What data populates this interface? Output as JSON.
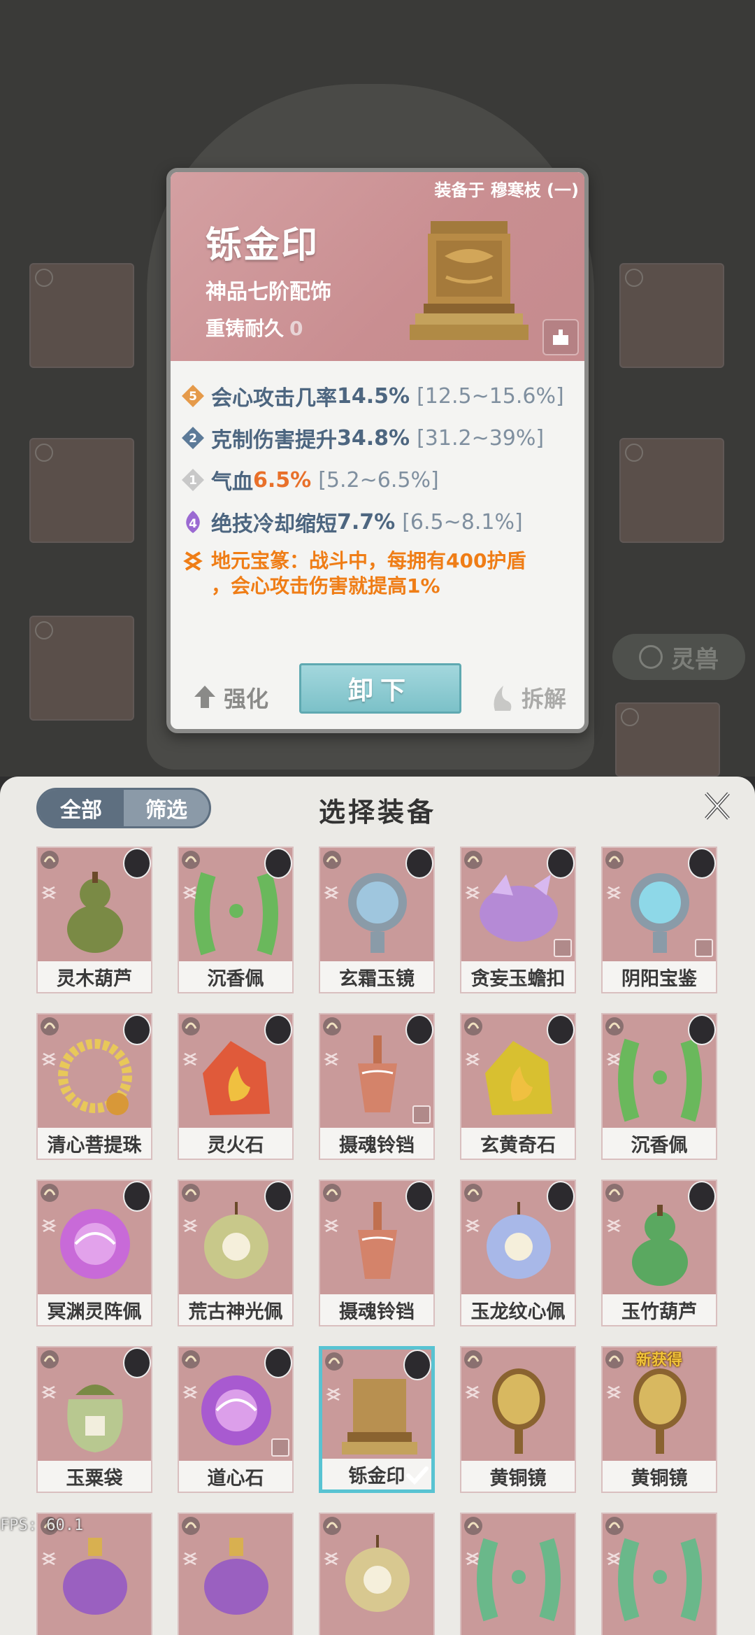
{
  "detail": {
    "equipped_on": "装备于 穆寒枝 (一)",
    "name": "铄金印",
    "grade": "神品七阶配饰",
    "reforge_label": "重铸耐久",
    "reforge_value": "0",
    "stats": [
      {
        "badge": "5",
        "badge_color": "#e59a4a",
        "label": "会心攻击几率 ",
        "value": "14.5%",
        "value_color": "#4d6680",
        "range": "[12.5~15.6%]"
      },
      {
        "badge": "2",
        "badge_color": "#5c7a98",
        "label": "克制伤害提升",
        "value": "34.8%",
        "value_color": "#4d6680",
        "range": "[31.2~39%]"
      },
      {
        "badge": "1",
        "badge_color": "#c8c8c8",
        "label": "气血 ",
        "value": "6.5%",
        "value_color": "#e8702a",
        "range": "[5.2~6.5%]"
      },
      {
        "badge": "4",
        "badge_color": "#9b6ad2",
        "label": "绝技冷却缩短 ",
        "value": "7.7%",
        "value_color": "#4d6680",
        "range": "[6.5~8.1%]"
      }
    ],
    "special_line1": "地元宝篆：战斗中，每拥有400护盾",
    "special_line2": "，会心攻击伤害就提高1%",
    "enhance_label": "强化",
    "unequip_label": "卸下",
    "dismantle_label": "拆解"
  },
  "background": {
    "pill_label": "灵兽"
  },
  "panel": {
    "title": "选择装备",
    "tabs": [
      {
        "label": "全部"
      },
      {
        "label": "筛选"
      }
    ],
    "items": [
      {
        "name": "灵木葫芦",
        "color": "#7a8a45",
        "shape": "gourd",
        "portrait": true,
        "locked": false
      },
      {
        "name": "沉香佩",
        "color": "#6ab85c",
        "shape": "jade",
        "portrait": true,
        "locked": false
      },
      {
        "name": "玄霜玉镜",
        "color": "#9fc6de",
        "shape": "mirror",
        "portrait": true,
        "locked": false
      },
      {
        "name": "贪妄玉蟾扣",
        "color": "#b58ad6",
        "shape": "toad",
        "portrait": true,
        "locked": true
      },
      {
        "name": "阴阳宝鉴",
        "color": "#8ed8e8",
        "shape": "mirror",
        "portrait": true,
        "locked": true
      },
      {
        "name": "清心菩提珠",
        "color": "#e8c85a",
        "shape": "beads",
        "portrait": true,
        "locked": false
      },
      {
        "name": "灵火石",
        "color": "#e05a3a",
        "shape": "stone",
        "portrait": true,
        "locked": false
      },
      {
        "name": "摄魂铃铛",
        "color": "#d4836a",
        "shape": "bell",
        "portrait": true,
        "locked": true
      },
      {
        "name": "玄黄奇石",
        "color": "#d8c030",
        "shape": "stone",
        "portrait": true,
        "locked": false
      },
      {
        "name": "沉香佩",
        "color": "#6ab85c",
        "shape": "jade",
        "portrait": true,
        "locked": false
      },
      {
        "name": "冥渊灵阵佩",
        "color": "#c86ad8",
        "shape": "disc",
        "portrait": true,
        "locked": false
      },
      {
        "name": "荒古神光佩",
        "color": "#c8c88a",
        "shape": "pendant",
        "portrait": true,
        "locked": false
      },
      {
        "name": "摄魂铃铛",
        "color": "#d4836a",
        "shape": "bell",
        "portrait": true,
        "locked": false
      },
      {
        "name": "玉龙纹心佩",
        "color": "#a8b8e8",
        "shape": "pendant",
        "portrait": true,
        "locked": false
      },
      {
        "name": "玉竹葫芦",
        "color": "#5aa860",
        "shape": "gourd",
        "portrait": true,
        "locked": false
      },
      {
        "name": "玉粟袋",
        "color": "#b8c890",
        "shape": "bag",
        "portrait": true,
        "locked": false
      },
      {
        "name": "道心石",
        "color": "#a85ad0",
        "shape": "disc",
        "portrait": true,
        "locked": true
      },
      {
        "name": "铄金印",
        "color": "#b89050",
        "shape": "seal",
        "portrait": true,
        "locked": false,
        "selected": true
      },
      {
        "name": "黄铜镜",
        "color": "#d8b860",
        "shape": "hand-mirror",
        "portrait": false,
        "locked": false
      },
      {
        "name": "黄铜镜",
        "color": "#d8b860",
        "shape": "hand-mirror",
        "portrait": false,
        "locked": false,
        "new_tag": "新获得"
      },
      {
        "name": "",
        "color": "#9a60c0",
        "shape": "bottle",
        "portrait": false,
        "locked": false
      },
      {
        "name": "",
        "color": "#9a60c0",
        "shape": "bottle",
        "portrait": false,
        "locked": false
      },
      {
        "name": "",
        "color": "#d8c890",
        "shape": "pendant",
        "portrait": false,
        "locked": false
      },
      {
        "name": "",
        "color": "#6ab88a",
        "shape": "jade",
        "portrait": false,
        "locked": false
      },
      {
        "name": "",
        "color": "#6ab88a",
        "shape": "jade",
        "portrait": false,
        "locked": false
      }
    ]
  },
  "fps": "FPS: 60.1"
}
